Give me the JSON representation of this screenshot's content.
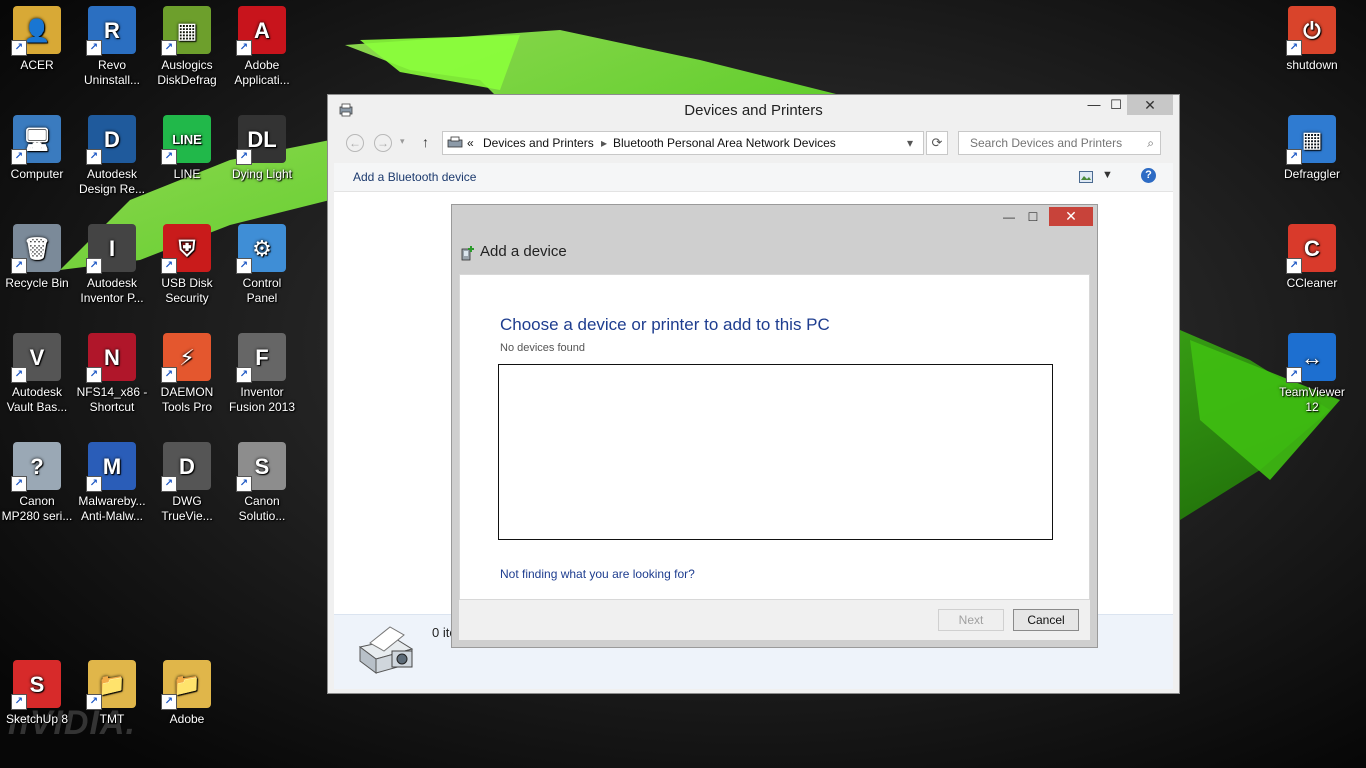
{
  "desktop": {
    "left_icons": [
      {
        "name": "acer",
        "label": "ACER",
        "color": "#d8a936",
        "glyph": "👤"
      },
      {
        "name": "revo-uninstaller",
        "label": "Revo Uninstall...",
        "color": "#2b6fc1",
        "glyph": "R"
      },
      {
        "name": "auslogics-diskdefrag",
        "label": "Auslogics DiskDefrag",
        "color": "#6d9f2c",
        "glyph": "▦"
      },
      {
        "name": "adobe-application",
        "label": "Adobe Applicati...",
        "color": "#c8141c",
        "glyph": "A"
      },
      {
        "name": "computer",
        "label": "Computer",
        "color": "#3a7bbf",
        "glyph": "🖥"
      },
      {
        "name": "autodesk-design-review",
        "label": "Autodesk Design Re...",
        "color": "#1f5a9c",
        "glyph": "D"
      },
      {
        "name": "line",
        "label": "LINE",
        "color": "#21b84a",
        "glyph": "LINE"
      },
      {
        "name": "dying-light",
        "label": "Dying Light",
        "color": "#333333",
        "glyph": "DL"
      },
      {
        "name": "recycle-bin",
        "label": "Recycle Bin",
        "color": "#7b8a99",
        "glyph": "🗑"
      },
      {
        "name": "autodesk-inventor-pro",
        "label": "Autodesk Inventor P...",
        "color": "#444444",
        "glyph": "I"
      },
      {
        "name": "usb-disk-security",
        "label": "USB Disk Security",
        "color": "#c91b1b",
        "glyph": "⛨"
      },
      {
        "name": "control-panel",
        "label": "Control Panel",
        "color": "#3f8ed6",
        "glyph": "⚙"
      },
      {
        "name": "autodesk-vault-basic",
        "label": "Autodesk Vault Bas...",
        "color": "#555555",
        "glyph": "V"
      },
      {
        "name": "nfs14-x86-shortcut",
        "label": "NFS14_x86 - Shortcut",
        "color": "#b0162a",
        "glyph": "N"
      },
      {
        "name": "daemon-tools-pro",
        "label": "DAEMON Tools Pro",
        "color": "#e4572e",
        "glyph": "⚡"
      },
      {
        "name": "inventor-fusion-2013",
        "label": "Inventor Fusion 2013",
        "color": "#666666",
        "glyph": "F"
      },
      {
        "name": "canon-mp280",
        "label": "Canon MP280 seri...",
        "color": "#9aa8b5",
        "glyph": "?"
      },
      {
        "name": "malwarebytes",
        "label": "Malwareby... Anti-Malw...",
        "color": "#2a5db8",
        "glyph": "M"
      },
      {
        "name": "dwg-trueview",
        "label": "DWG TrueVie...",
        "color": "#555555",
        "glyph": "D"
      },
      {
        "name": "canon-solution-menu",
        "label": "Canon Solutio...",
        "color": "#8d8d8d",
        "glyph": "S"
      },
      {
        "name": "sketchup-8",
        "label": "SketchUp 8",
        "color": "#d72a2a",
        "glyph": "S"
      },
      {
        "name": "tmt-folder",
        "label": "TMT",
        "color": "#e0b64a",
        "glyph": "📁"
      },
      {
        "name": "adobe-folder",
        "label": "Adobe",
        "color": "#e0b64a",
        "glyph": "📁"
      }
    ],
    "right_icons": [
      {
        "name": "shutdown",
        "label": "shutdown",
        "color": "#d9442b",
        "glyph": "⏻"
      },
      {
        "name": "defraggler",
        "label": "Defraggler",
        "color": "#2f7bd1",
        "glyph": "▦"
      },
      {
        "name": "ccleaner",
        "label": "CCleaner",
        "color": "#d93a2b",
        "glyph": "C"
      },
      {
        "name": "teamviewer-12",
        "label": "TeamViewer 12",
        "color": "#1d6fd0",
        "glyph": "↔"
      }
    ],
    "watermark": "nVIDIA."
  },
  "window": {
    "title": "Devices and Printers",
    "minimize": "—",
    "maximize": "☐",
    "close": "✕",
    "address": {
      "chevrons": "«",
      "crumb1": "Devices and Printers",
      "crumb2": "Bluetooth Personal Area Network Devices",
      "dropdown": "▾"
    },
    "search_placeholder": "Search Devices and Printers",
    "command": "Add a Bluetooth device",
    "item_count": "0 ite",
    "help": "?"
  },
  "dialog": {
    "title": "Add a device",
    "heading": "Choose a device or printer to add to this PC",
    "status": "No devices found",
    "help_link": "Not finding what you are looking for?",
    "next_label": "Next",
    "cancel_label": "Cancel",
    "minimize": "—",
    "maximize": "☐",
    "close": "✕"
  }
}
